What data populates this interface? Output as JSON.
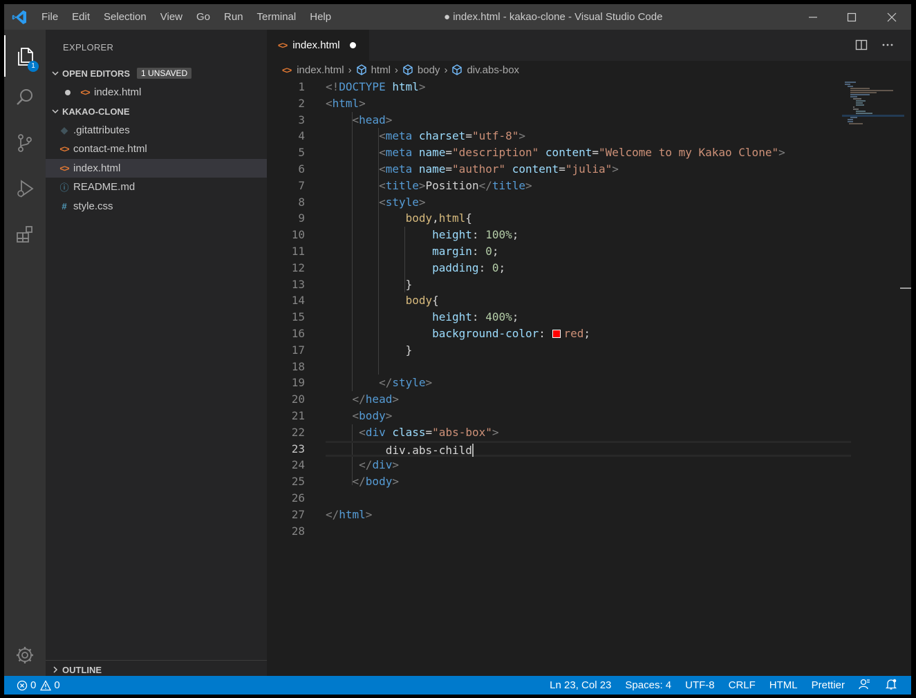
{
  "window_title": "● index.html - kakao-clone - Visual Studio Code",
  "menu": [
    "File",
    "Edit",
    "Selection",
    "View",
    "Go",
    "Run",
    "Terminal",
    "Help"
  ],
  "activity_bar": {
    "items": [
      "explorer-icon",
      "search-icon",
      "source-control-icon",
      "run-debug-icon",
      "extensions-icon",
      "settings-gear-icon"
    ],
    "explorer_badge": "1"
  },
  "sidebar": {
    "title": "EXPLORER",
    "open_editors": {
      "label": "OPEN EDITORS",
      "badge": "1 UNSAVED",
      "files": [
        "index.html"
      ]
    },
    "project": {
      "label": "KAKAO-CLONE",
      "files": [
        ".gitattributes",
        "contact-me.html",
        "index.html",
        "README.md",
        "style.css"
      ]
    },
    "outline_label": "OUTLINE"
  },
  "tab": {
    "label": "index.html",
    "modified": true
  },
  "breadcrumbs": [
    "index.html",
    "html",
    "body",
    "div.abs-box"
  ],
  "editor": {
    "line_numbers": [
      "1",
      "2",
      "3",
      "4",
      "5",
      "6",
      "7",
      "8",
      "9",
      "10",
      "11",
      "12",
      "13",
      "14",
      "15",
      "16",
      "17",
      "18",
      "19",
      "20",
      "21",
      "22",
      "23",
      "24",
      "25",
      "26",
      "27",
      "28"
    ],
    "current_line": 23,
    "swatch_color": "#ff0000"
  },
  "status_bar": {
    "errors": "0",
    "warnings": "0",
    "position": "Ln 23, Col 23",
    "spaces": "Spaces: 4",
    "encoding": "UTF-8",
    "eol": "CRLF",
    "language": "HTML",
    "formatter": "Prettier"
  }
}
